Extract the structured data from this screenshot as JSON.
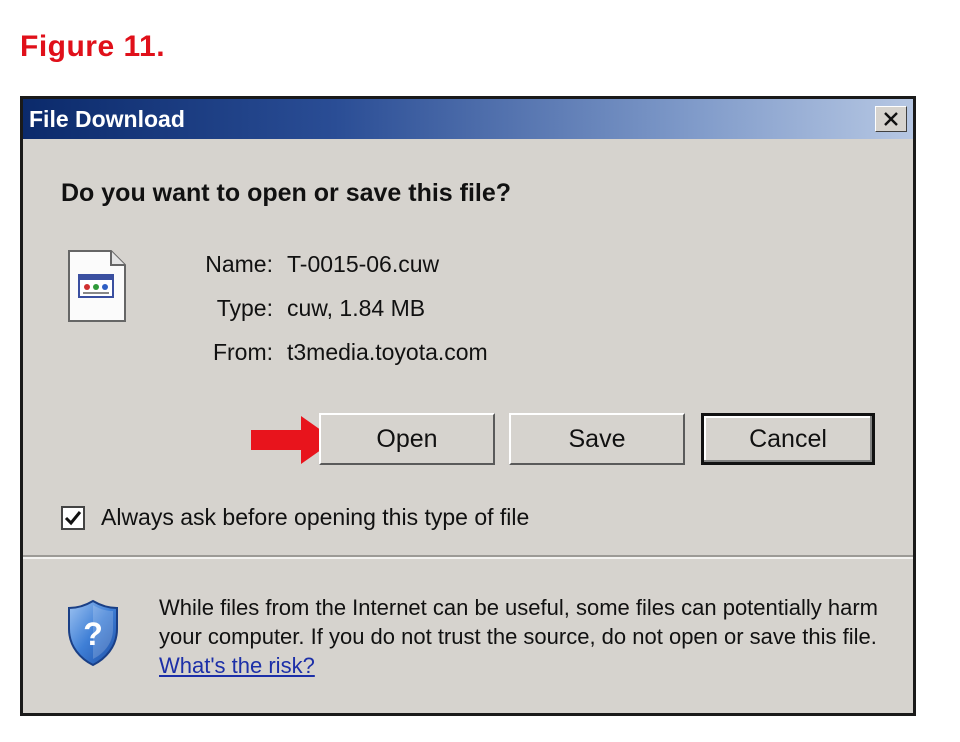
{
  "figure_label": "Figure 11.",
  "dialog": {
    "title": "File Download",
    "question": "Do you want to open or save this file?",
    "file": {
      "name_label": "Name:",
      "name_value": "T-0015-06.cuw",
      "type_label": "Type:",
      "type_value": "cuw, 1.84 MB",
      "from_label": "From:",
      "from_value": "t3media.toyota.com"
    },
    "buttons": {
      "open": "Open",
      "save": "Save",
      "cancel": "Cancel"
    },
    "checkbox": {
      "label": "Always ask before opening this type of file",
      "checked": true
    },
    "warning": {
      "text": "While files from the Internet can be useful, some files can potentially harm your computer. If you do not trust the source, do not open or save this file.",
      "link": "What's the risk?"
    }
  },
  "colors": {
    "figure_label": "#e0101a",
    "arrow": "#e8141c",
    "titlebar_start": "#0b2a6b",
    "titlebar_end": "#b6c7e3",
    "dialog_bg": "#d6d3ce",
    "link": "#1c2fa8"
  },
  "icons": [
    "file-icon",
    "close-icon",
    "red-arrow-icon",
    "checkmark-icon",
    "shield-question-icon"
  ]
}
